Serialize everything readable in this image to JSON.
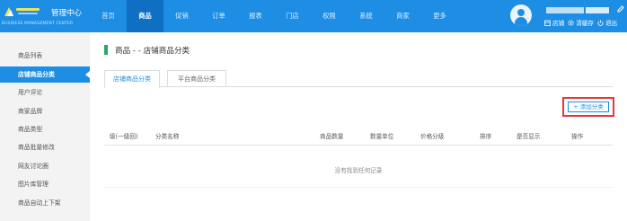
{
  "colors": {
    "primary": "#1e8ee5",
    "nav_active": "#0f6fc2",
    "highlight": "#e53935",
    "title_bar": "#2aa66a"
  },
  "header": {
    "title": "管理中心",
    "subtitle": "BUSINESS MANAGEMENT CENTER",
    "nav": [
      {
        "label": "首页",
        "active": false
      },
      {
        "label": "商品",
        "active": true
      },
      {
        "label": "促销",
        "active": false
      },
      {
        "label": "订单",
        "active": false
      },
      {
        "label": "报表",
        "active": false
      },
      {
        "label": "门店",
        "active": false
      },
      {
        "label": "权限",
        "active": false
      },
      {
        "label": "系统",
        "active": false
      },
      {
        "label": "商家",
        "active": false
      },
      {
        "label": "更多",
        "active": false
      }
    ],
    "actions": [
      {
        "label": "店铺",
        "icon": "store-icon"
      },
      {
        "label": "清缓存",
        "icon": "gear-icon"
      },
      {
        "label": "退出",
        "icon": "power-icon"
      }
    ]
  },
  "sidebar": {
    "items": [
      {
        "label": "商品列表",
        "active": false
      },
      {
        "label": "店铺商品分类",
        "active": true
      },
      {
        "label": "用户评论",
        "active": false
      },
      {
        "label": "商家品牌",
        "active": false
      },
      {
        "label": "商品类型",
        "active": false
      },
      {
        "label": "商品批量修改",
        "active": false
      },
      {
        "label": "网友讨论圈",
        "active": false
      },
      {
        "label": "图片库管理",
        "active": false
      },
      {
        "label": "商品自动上下架",
        "active": false
      }
    ]
  },
  "main": {
    "title": "商品 - - 店铺商品分类",
    "tabs": [
      {
        "label": "店铺商品分类",
        "active": true
      },
      {
        "label": "平台商品分类",
        "active": false
      }
    ],
    "add_button": "+ 添加分类",
    "table": {
      "columns": [
        "级(一级回)",
        "分类名称",
        "商品数量",
        "数量单位",
        "价格分级",
        "排序",
        "是否显示",
        "操作"
      ],
      "rows": [],
      "empty_text": "没有找到任何记录"
    }
  }
}
